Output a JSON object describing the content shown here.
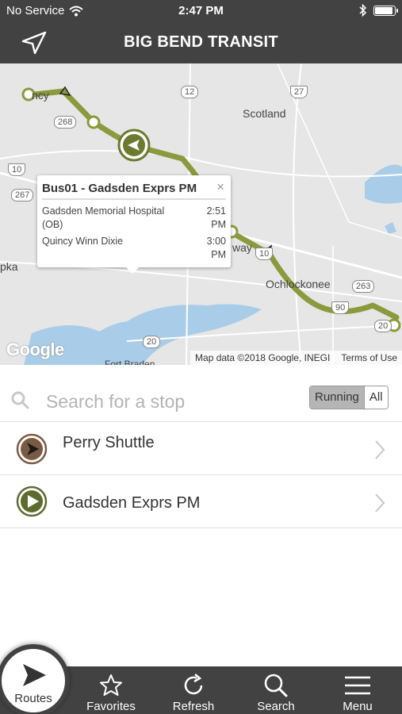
{
  "status_bar": {
    "carrier": "No Service",
    "time": "2:47 PM",
    "battery_level": 0.95
  },
  "header": {
    "title": "BIG BEND TRANSIT",
    "location_icon": "location-arrow-icon"
  },
  "map": {
    "places": [
      "Scotland",
      "Ochlockonee",
      "pka",
      "ncy",
      "way",
      "Fort Braden"
    ],
    "highway_shields": [
      "12",
      "27",
      "268",
      "10",
      "267",
      "263",
      "10",
      "20",
      "20",
      "90"
    ],
    "logo": "Google",
    "attribution": "Map data ©2018 Google, INEGI",
    "terms": "Terms of Use",
    "route_color": "#8a9a3c",
    "bus_marker_color": "#6b7a2e"
  },
  "popup": {
    "title": "Bus01 - Gadsden Exprs PM",
    "close_symbol": "×",
    "stops": [
      {
        "name": "Gadsden Memorial Hospital (OB)",
        "time": "2:51 PM"
      },
      {
        "name": "Quincy Winn Dixie",
        "time": "3:00 PM"
      }
    ]
  },
  "search": {
    "placeholder": "Search for a stop",
    "filter_options": [
      "Running",
      "All"
    ],
    "selected_filter": "Running"
  },
  "routes": [
    {
      "label": "Perry Shuttle",
      "icon_color": "#7b5a43"
    },
    {
      "label": "Gadsden Exprs PM",
      "icon_color": "#5e6b2f"
    }
  ],
  "tabbar": {
    "items": [
      {
        "label": "Routes",
        "icon": "routes-arrow-icon",
        "active": true
      },
      {
        "label": "Favorites",
        "icon": "star-icon",
        "active": false
      },
      {
        "label": "Refresh",
        "icon": "refresh-icon",
        "active": false
      },
      {
        "label": "Search",
        "icon": "magnifier-icon",
        "active": false
      },
      {
        "label": "Menu",
        "icon": "hamburger-menu-icon",
        "active": false
      }
    ]
  }
}
